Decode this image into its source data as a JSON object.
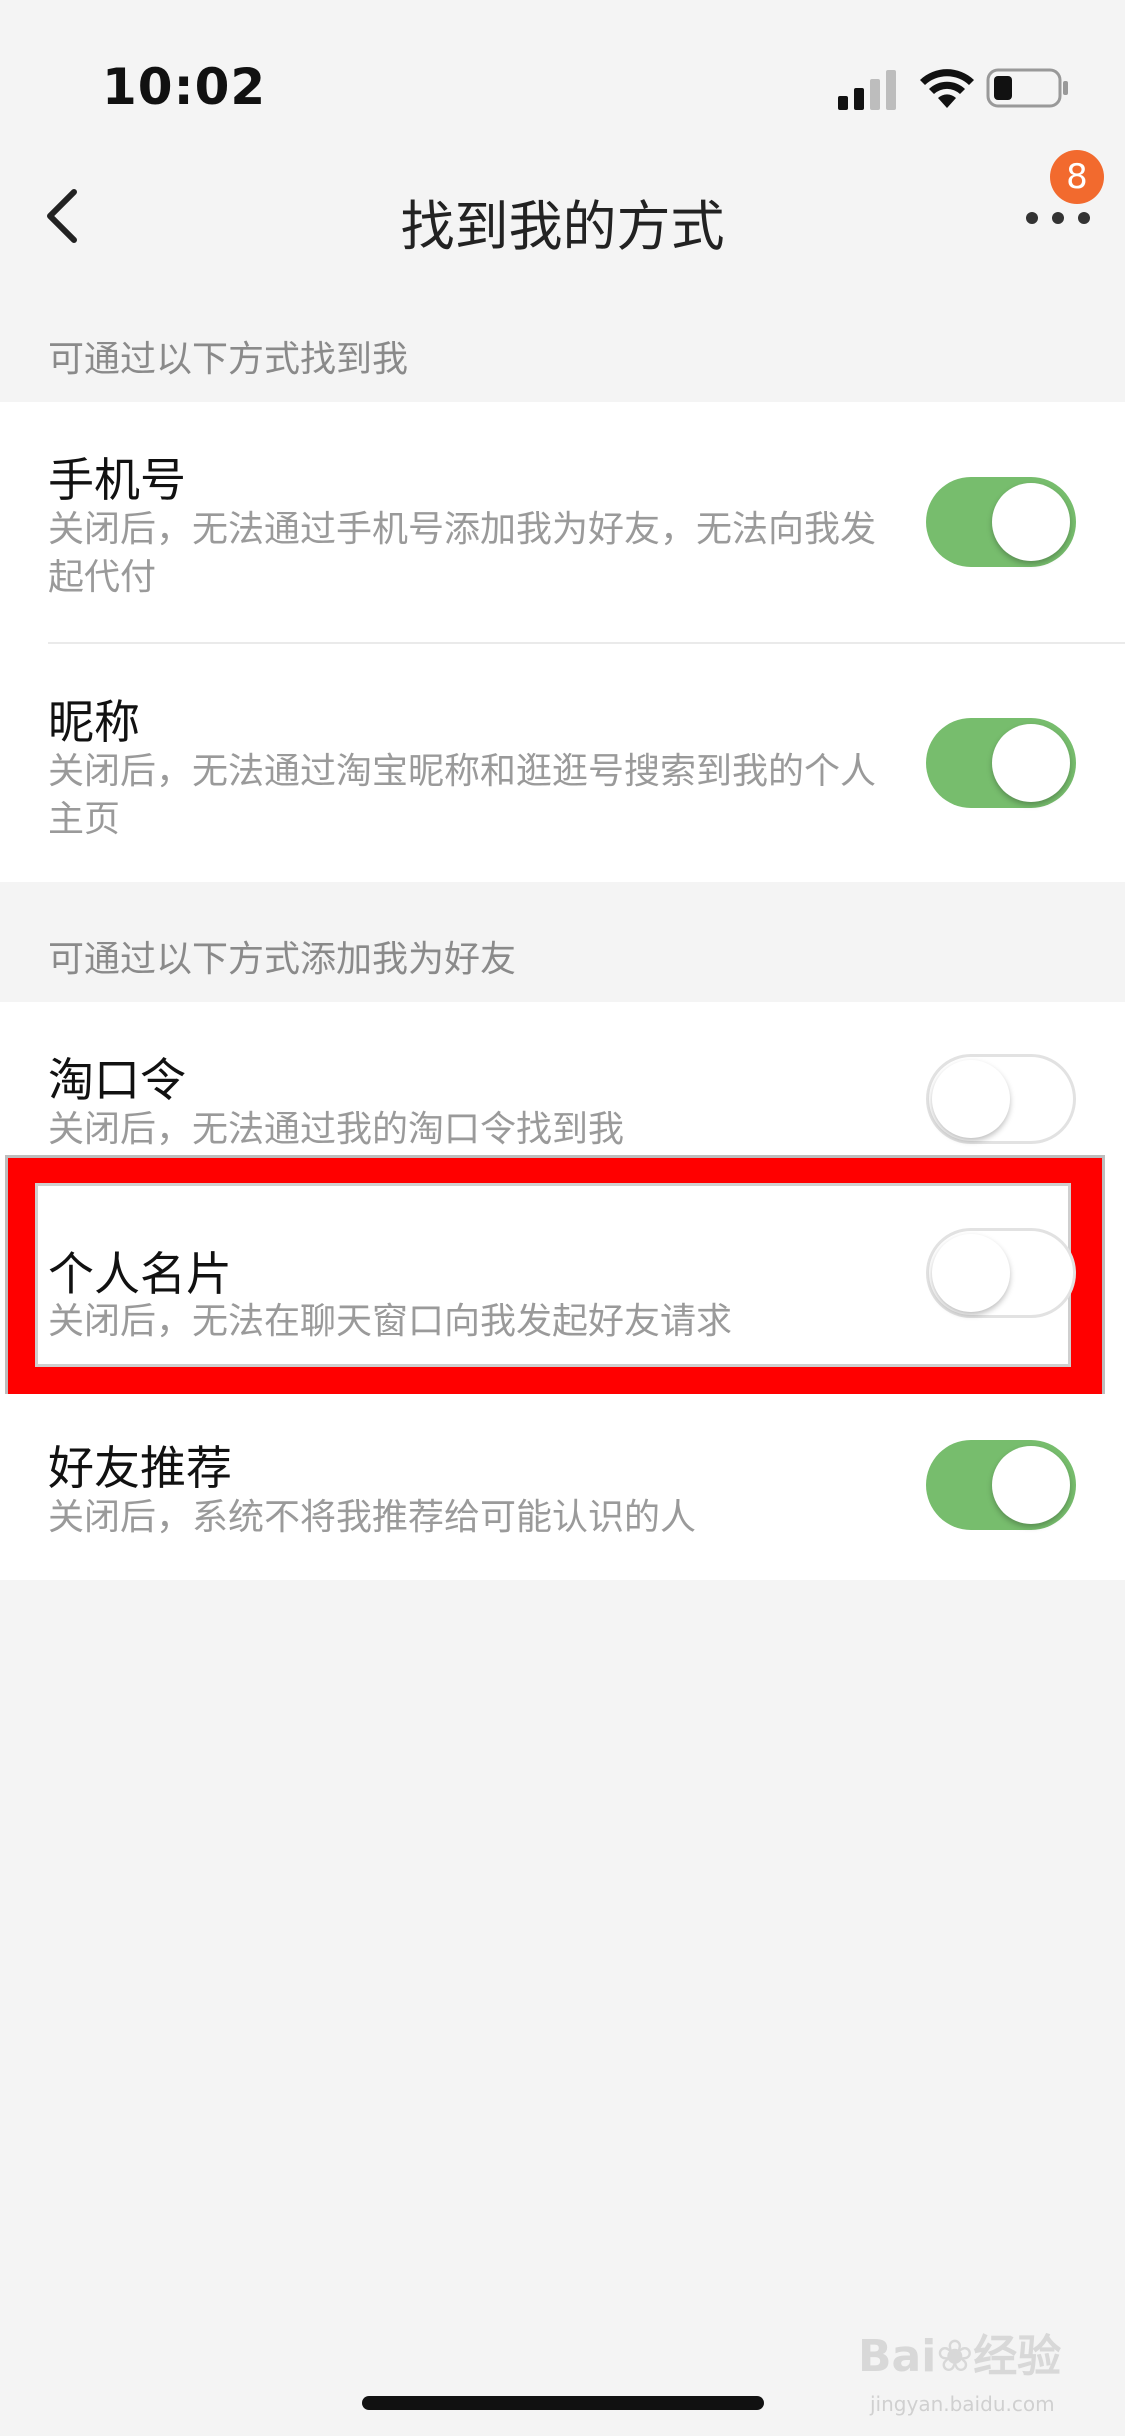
{
  "status_bar": {
    "time": "10:02"
  },
  "nav": {
    "title": "找到我的方式",
    "badge_count": "8"
  },
  "sections": [
    {
      "header": "可通过以下方式找到我",
      "items": [
        {
          "title": "手机号",
          "desc": "关闭后，无法通过手机号添加我为好友，无法向我发起代付",
          "enabled": true
        },
        {
          "title": "昵称",
          "desc": "关闭后，无法通过淘宝昵称和逛逛号搜索到我的个人主页",
          "enabled": true
        }
      ]
    },
    {
      "header": "可通过以下方式添加我为好友",
      "items": [
        {
          "title": "淘口令",
          "desc": "关闭后，无法通过我的淘口令找到我",
          "enabled": false
        },
        {
          "title": "个人名片",
          "desc": "关闭后，无法在聊天窗口向我发起好友请求",
          "enabled": false
        },
        {
          "title": "好友推荐",
          "desc": "关闭后，系统不将我推荐给可能认识的人",
          "enabled": true
        }
      ]
    }
  ],
  "colors": {
    "toggle_on": "#77bd6d",
    "badge": "#f26a2e",
    "highlight": "#ff0000"
  },
  "watermark": {
    "brand": "Bai",
    "suffix": "经验",
    "url": "jingyan.baidu.com"
  }
}
